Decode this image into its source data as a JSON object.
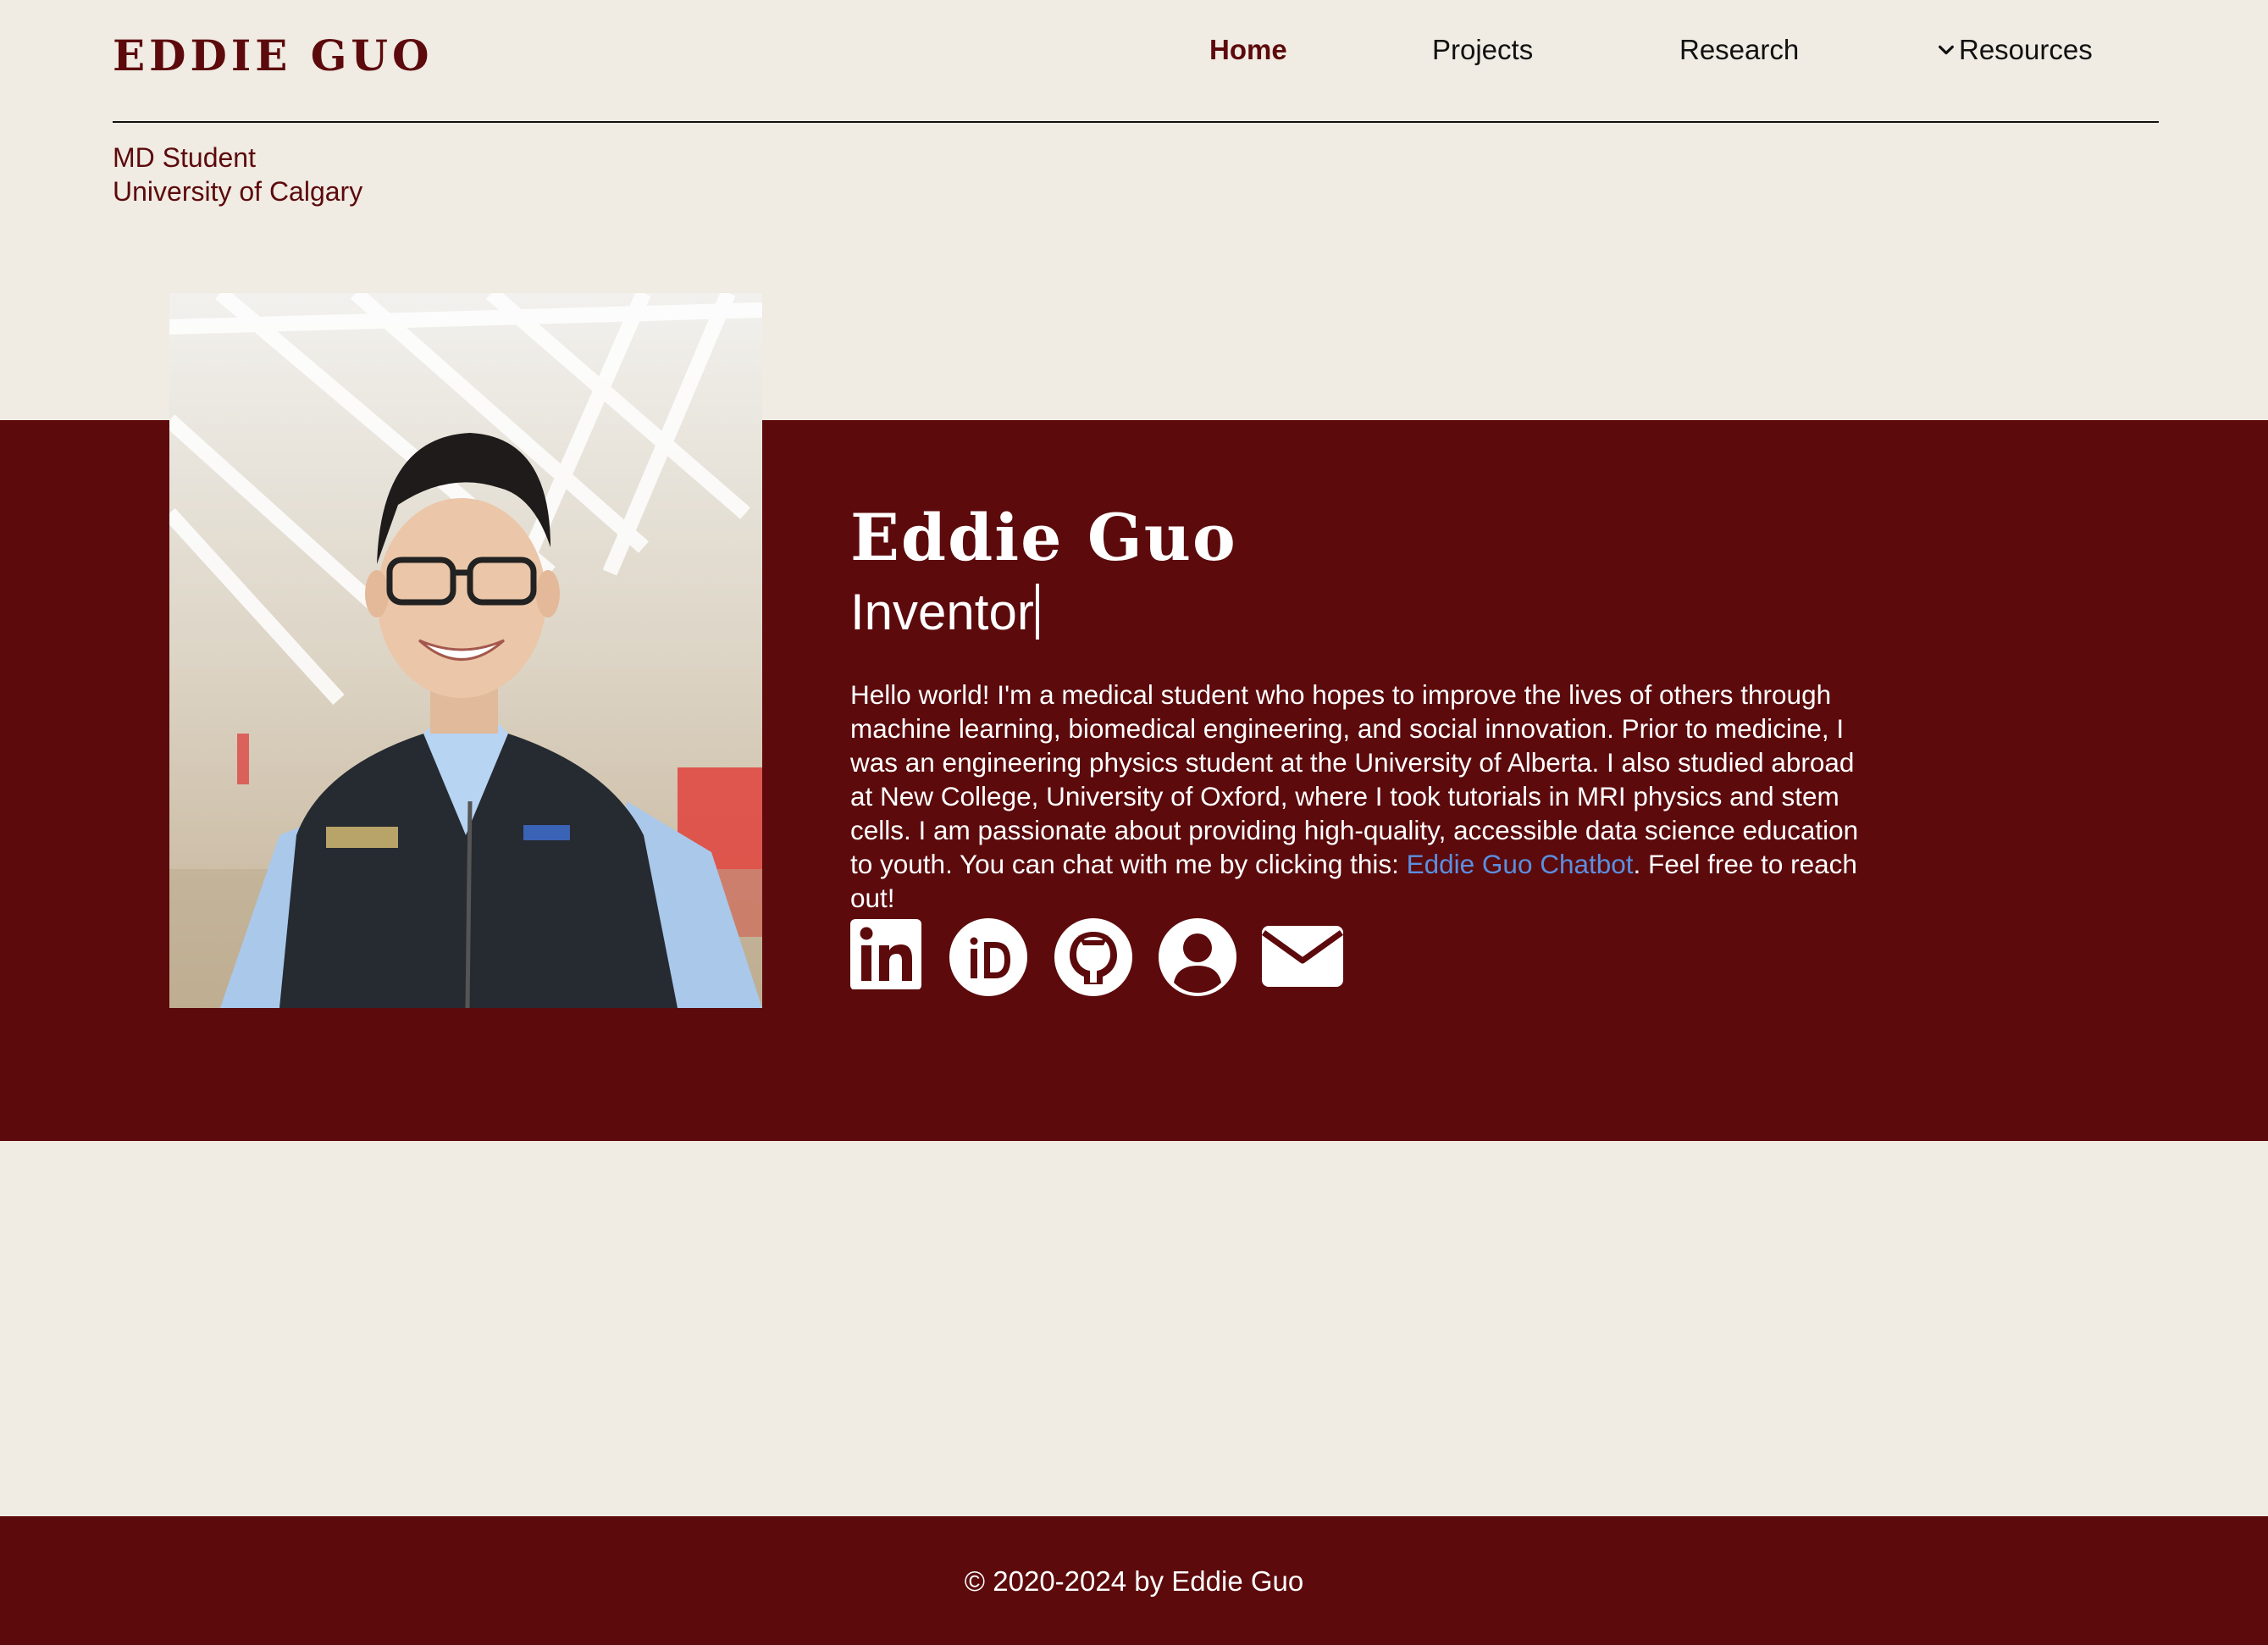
{
  "header": {
    "brand": "EDDIE GUO",
    "nav": [
      {
        "label": "Home",
        "active": true
      },
      {
        "label": "Projects"
      },
      {
        "label": "Research"
      },
      {
        "label": "Resources",
        "icon": "chevron-down-icon"
      }
    ],
    "subtitle_line1": "MD Student",
    "subtitle_line2": "University of Calgary"
  },
  "hero": {
    "name": "Eddie Guo",
    "role": "Inventor",
    "bio_before_link": "Hello world! I'm a medical student who hopes to improve the lives of others through machine learning, biomedical engineering, and social innovation. Prior to medicine, I was an engineering physics student at the University of Alberta. I also studied abroad at New College, University of Oxford, where I took tutorials in MRI physics and stem cells. I am passionate about providing high-quality, accessible data science education to youth. You can chat with me by clicking this: ",
    "bio_link": "Eddie Guo Chatbot",
    "bio_after_link": ". Feel free to reach out!",
    "socials": [
      "linkedin-icon",
      "orcid-icon",
      "github-icon",
      "profile-icon",
      "email-icon"
    ]
  },
  "footer": {
    "copyright": "© 2020-2024 by Eddie Guo"
  },
  "colors": {
    "brand": "#5c0a0c",
    "background": "#f0ebe3",
    "link": "#5b8fe0"
  }
}
